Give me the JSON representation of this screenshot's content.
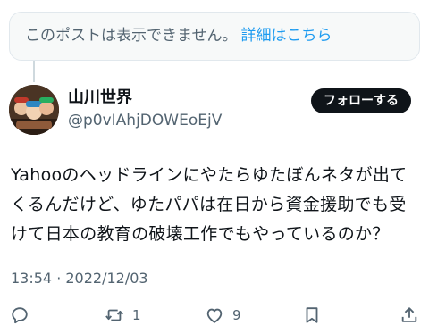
{
  "unavailable": {
    "message": "このポストは表示できません。",
    "link": "詳細はこちら"
  },
  "author": {
    "display_name": "山川世界",
    "handle": "@p0vIAhjDOWEoEjV",
    "follow_label": "フォローする"
  },
  "post": {
    "lines": [
      "Yahooのヘッドラインにやたらゆたぼんネタが出て",
      "くるんだけど、ゆたパパは在日から資金援助でも受",
      "けて日本の教育の破壊工作でもやっているのか？"
    ],
    "timestamp": "13:54 · 2022/12/03"
  },
  "actions": {
    "reply_icon": "reply-icon",
    "retweet_icon": "retweet-icon",
    "retweet_count": "1",
    "like_icon": "like-icon",
    "like_count": "9",
    "bookmark_icon": "bookmark-icon",
    "share_icon": "share-icon"
  },
  "colors": {
    "accent": "#1d9bf0",
    "text_primary": "#0f1419",
    "text_secondary": "#536471"
  }
}
